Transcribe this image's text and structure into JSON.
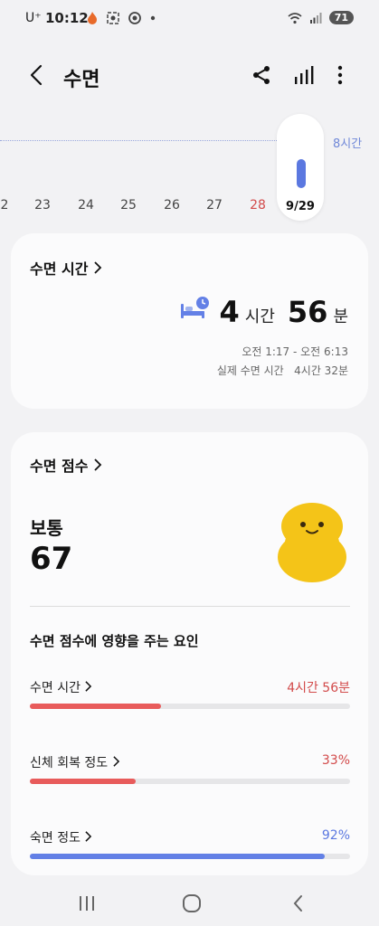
{
  "status_bar": {
    "carrier": "U⁺",
    "time": "10:12",
    "battery": "71"
  },
  "header": {
    "title": "수면"
  },
  "date_strip": {
    "goal_label": "8시간",
    "days": [
      "2",
      "23",
      "24",
      "25",
      "26",
      "27",
      "28"
    ],
    "selected_day": "9/29",
    "accent_color": "#5b78e0",
    "highlight_day_color": "#d24a4a"
  },
  "sleep_time_card": {
    "title": "수면 시간",
    "hours": "4",
    "hours_unit": "시간",
    "minutes": "56",
    "minutes_unit": "분",
    "time_range": "오전 1:17 - 오전 6:13",
    "actual_label": "실제 수면 시간",
    "actual_value": "4시간 32분"
  },
  "score_card": {
    "title": "수면 점수",
    "status": "보통",
    "score": "67",
    "factors_title": "수면 점수에 영향을 주는 요인",
    "factors": [
      {
        "label": "수면 시간",
        "value": "4시간 56분",
        "progress": 0.41,
        "color": "#e85b5b",
        "value_color": "#d24a4a"
      },
      {
        "label": "신체 회복 정도",
        "value": "33%",
        "progress": 0.33,
        "color": "#e85b5b",
        "value_color": "#d24a4a"
      },
      {
        "label": "숙면 정도",
        "value": "92%",
        "progress": 0.92,
        "color": "#6380e6",
        "value_color": "#5b78e0"
      }
    ]
  }
}
